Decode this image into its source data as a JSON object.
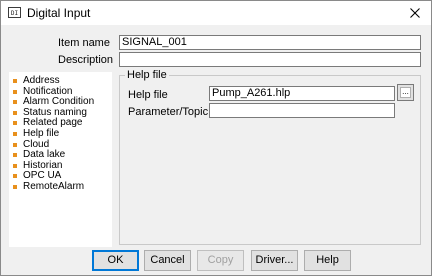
{
  "window": {
    "title": "Digital Input",
    "icon_text": "DI",
    "icon_name": "digital-input-app-icon",
    "close_icon": "close-icon"
  },
  "form": {
    "item_name_label": "Item name",
    "item_name_value": "SIGNAL_001",
    "description_label": "Description",
    "description_value": ""
  },
  "nav": {
    "bullet_color": "#e8901c",
    "items": [
      {
        "label": "Address"
      },
      {
        "label": "Notification"
      },
      {
        "label": "Alarm Condition"
      },
      {
        "label": "Status naming"
      },
      {
        "label": "Related page"
      },
      {
        "label": "Help file"
      },
      {
        "label": "Cloud"
      },
      {
        "label": "Data lake"
      },
      {
        "label": "Historian"
      },
      {
        "label": "OPC UA"
      },
      {
        "label": "RemoteAlarm"
      }
    ]
  },
  "helpfile": {
    "group_title": "Help file",
    "help_file_label": "Help file",
    "help_file_value": "Pump_A261.hlp",
    "browse_label": "...",
    "parameter_label": "Parameter/Topic",
    "parameter_value": ""
  },
  "buttons": {
    "ok": "OK",
    "cancel": "Cancel",
    "copy": "Copy",
    "driver": "Driver...",
    "help": "Help"
  }
}
